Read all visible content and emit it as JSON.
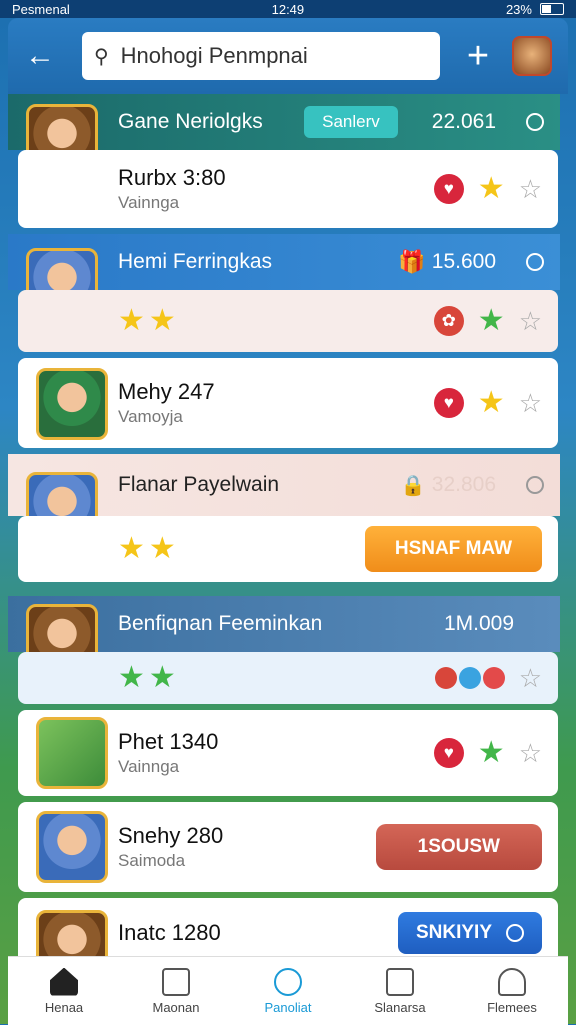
{
  "status": {
    "left": "Pesmenal",
    "time": "12:49",
    "battery": "23%"
  },
  "header": {
    "search_value": "Hnohogi Penmpnai"
  },
  "groups": [
    {
      "title": "Gane Neriolgks",
      "pill": "Sanlerv",
      "value": "22.061"
    },
    {
      "title": "Hemi Ferringkas",
      "value": "15.600"
    },
    {
      "title": "Flanar Payelwain",
      "value": "32.806"
    },
    {
      "title": "Benfiqnan Feeminkan",
      "value": "1M.009"
    }
  ],
  "rows": [
    {
      "title": "Rurbx 3:80",
      "sub": "Vainnga"
    },
    {
      "title": "Mehy 247",
      "sub": "Vamoyja"
    },
    {
      "title": "Phet 1340",
      "sub": "Vainnga"
    },
    {
      "title": "Snehy 280",
      "sub": "Saimoda"
    },
    {
      "title": "Inatc 1280",
      "sub": ""
    }
  ],
  "buttons": {
    "orange": "HSNAF MAW",
    "red": "1SOUSW",
    "blue": "SNKIYIY"
  },
  "nav": [
    {
      "label": "Henaa"
    },
    {
      "label": "Maonan"
    },
    {
      "label": "Panoliat"
    },
    {
      "label": "Slanarsa"
    },
    {
      "label": "Flemees"
    }
  ],
  "colors": {
    "accent": "#1a9ad6",
    "header": "#1f6aad",
    "orange": "#f08d1a",
    "red": "#b84a3e"
  }
}
